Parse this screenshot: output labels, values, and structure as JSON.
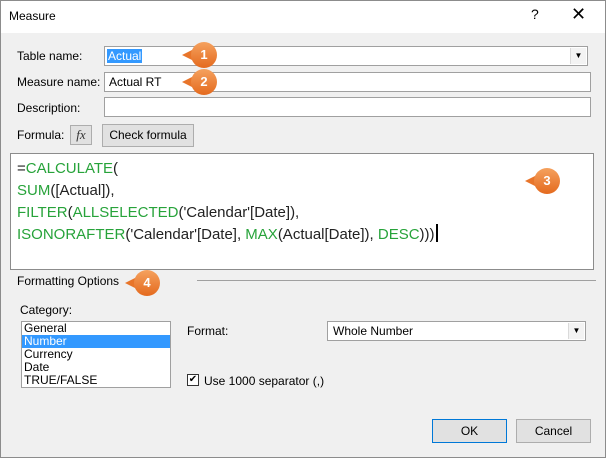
{
  "window": {
    "title": "Measure",
    "help": "?",
    "close": "✕"
  },
  "table_name": {
    "label": "Table name:",
    "value": "Actual"
  },
  "measure_name": {
    "label": "Measure name:",
    "value": "Actual RT"
  },
  "description": {
    "label": "Description:",
    "value": ""
  },
  "formula": {
    "label": "Formula:",
    "fx": "fx",
    "check_label": "Check formula",
    "lines": [
      [
        {
          "t": "=",
          "c": "dark"
        },
        {
          "t": "CALCULATE",
          "c": "fn"
        },
        {
          "t": "(",
          "c": "dark"
        }
      ],
      [
        {
          "t": "SUM",
          "c": "fn"
        },
        {
          "t": "([Actual]),",
          "c": "dark"
        }
      ],
      [
        {
          "t": "FILTER",
          "c": "fn"
        },
        {
          "t": "(",
          "c": "dark"
        },
        {
          "t": "ALLSELECTED",
          "c": "fn"
        },
        {
          "t": "('Calendar'[Date]),",
          "c": "dark"
        }
      ],
      [
        {
          "t": "ISONORAFTER",
          "c": "fn"
        },
        {
          "t": "('Calendar'[Date], ",
          "c": "dark"
        },
        {
          "t": "MAX",
          "c": "fn"
        },
        {
          "t": "(Actual[Date]), ",
          "c": "dark"
        },
        {
          "t": "DESC",
          "c": "fn"
        },
        {
          "t": ")))",
          "c": "dark"
        }
      ]
    ]
  },
  "formatting": {
    "heading": "Formatting Options",
    "category_label": "Category:",
    "categories": [
      "General",
      "Number",
      "Currency",
      "Date",
      "TRUE/FALSE"
    ],
    "selected_category": "Number",
    "format_label": "Format:",
    "format_value": "Whole Number",
    "separator_label": "Use 1000 separator (,)",
    "separator_checked": true
  },
  "buttons": {
    "ok": "OK",
    "cancel": "Cancel"
  },
  "callouts": [
    "1",
    "2",
    "3",
    "4"
  ],
  "colors": {
    "accent": "#3399ff",
    "callout": "#e8752a",
    "formula_fn": "#27a33a"
  }
}
